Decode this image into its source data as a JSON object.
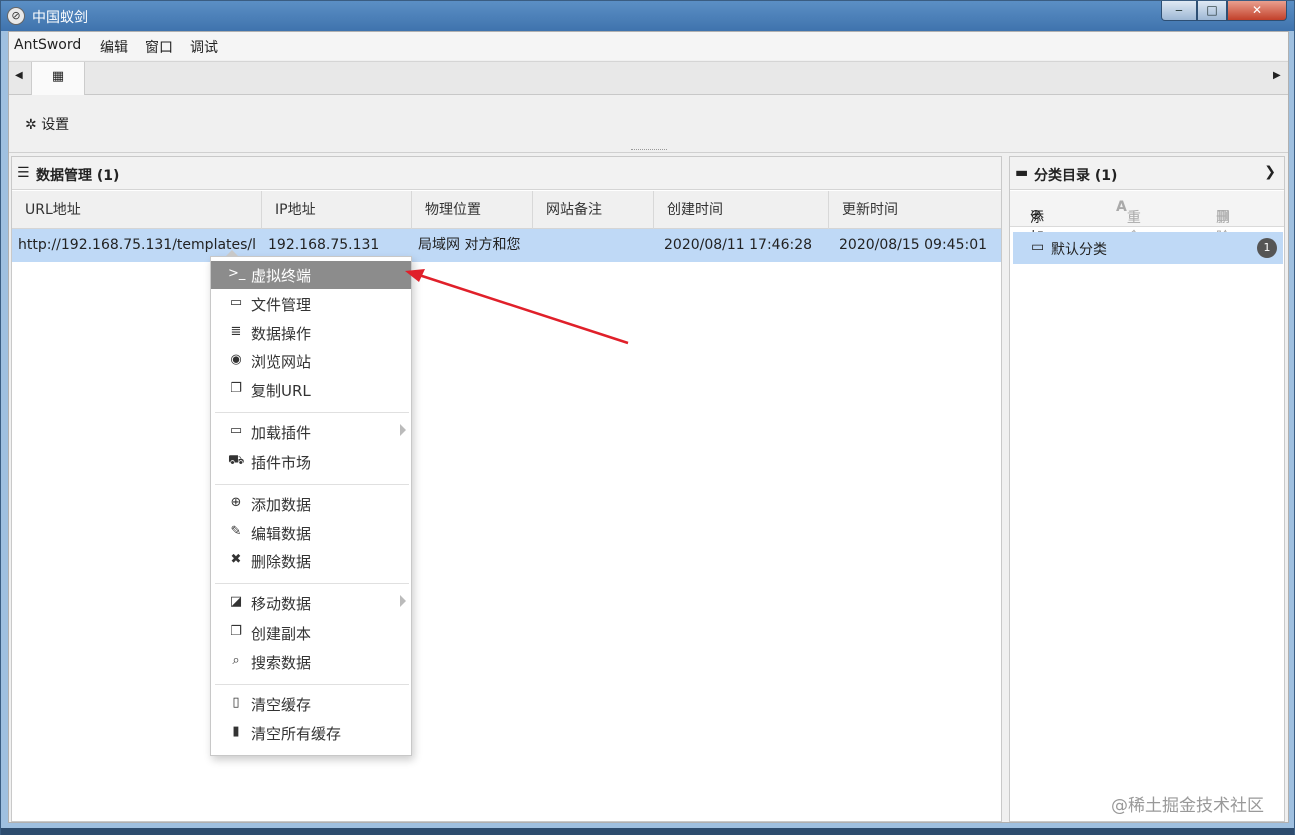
{
  "window": {
    "title": "中国蚁剑",
    "minimize": "‒",
    "maximize": "□",
    "close": "✕"
  },
  "menubar": [
    "AntSword",
    "编辑",
    "窗口",
    "调试"
  ],
  "tabs": {
    "left_arrow": "◀",
    "right_arrow": "▶",
    "home": "▦"
  },
  "toolbar": {
    "settings": "设置"
  },
  "data_panel": {
    "title": "数据管理 (1)",
    "columns": [
      "URL地址",
      "IP地址",
      "物理位置",
      "网站备注",
      "创建时间",
      "更新时间"
    ],
    "rows": [
      [
        "http://192.168.75.131/templates/l",
        "192.168.75.131",
        "局域网 对方和您",
        "",
        "2020/08/11 17:46:28",
        "2020/08/15 09:45:01"
      ]
    ]
  },
  "category_panel": {
    "title": "分类目录 (1)",
    "add": "添加",
    "rename": "重命名",
    "delete": "删除",
    "items": [
      {
        "label": "默认分类",
        "count": "1"
      }
    ]
  },
  "context_menu": {
    "groups": [
      [
        {
          "label": "虚拟终端",
          "icon": ">_",
          "highlighted": true
        },
        {
          "label": "文件管理",
          "icon": "folder"
        },
        {
          "label": "数据操作",
          "icon": "database"
        },
        {
          "label": "浏览网站",
          "icon": "chrome"
        },
        {
          "label": "复制URL",
          "icon": "copy"
        }
      ],
      [
        {
          "label": "加载插件",
          "icon": "folder",
          "submenu": true
        },
        {
          "label": "插件市场",
          "icon": "cart"
        }
      ],
      [
        {
          "label": "添加数据",
          "icon": "plus-circle"
        },
        {
          "label": "编辑数据",
          "icon": "edit"
        },
        {
          "label": "删除数据",
          "icon": "times"
        }
      ],
      [
        {
          "label": "移动数据",
          "icon": "share",
          "submenu": true
        },
        {
          "label": "创建副本",
          "icon": "copy"
        },
        {
          "label": "搜索数据",
          "icon": "search"
        }
      ],
      [
        {
          "label": "清空缓存",
          "icon": "trash-o"
        },
        {
          "label": "清空所有缓存",
          "icon": "trash"
        }
      ]
    ]
  },
  "watermark": "@稀土掘金技术社区",
  "colors": {
    "selection": "#bfd9f6",
    "highlight": "#8c8c8c",
    "arrow": "#e0202a"
  }
}
